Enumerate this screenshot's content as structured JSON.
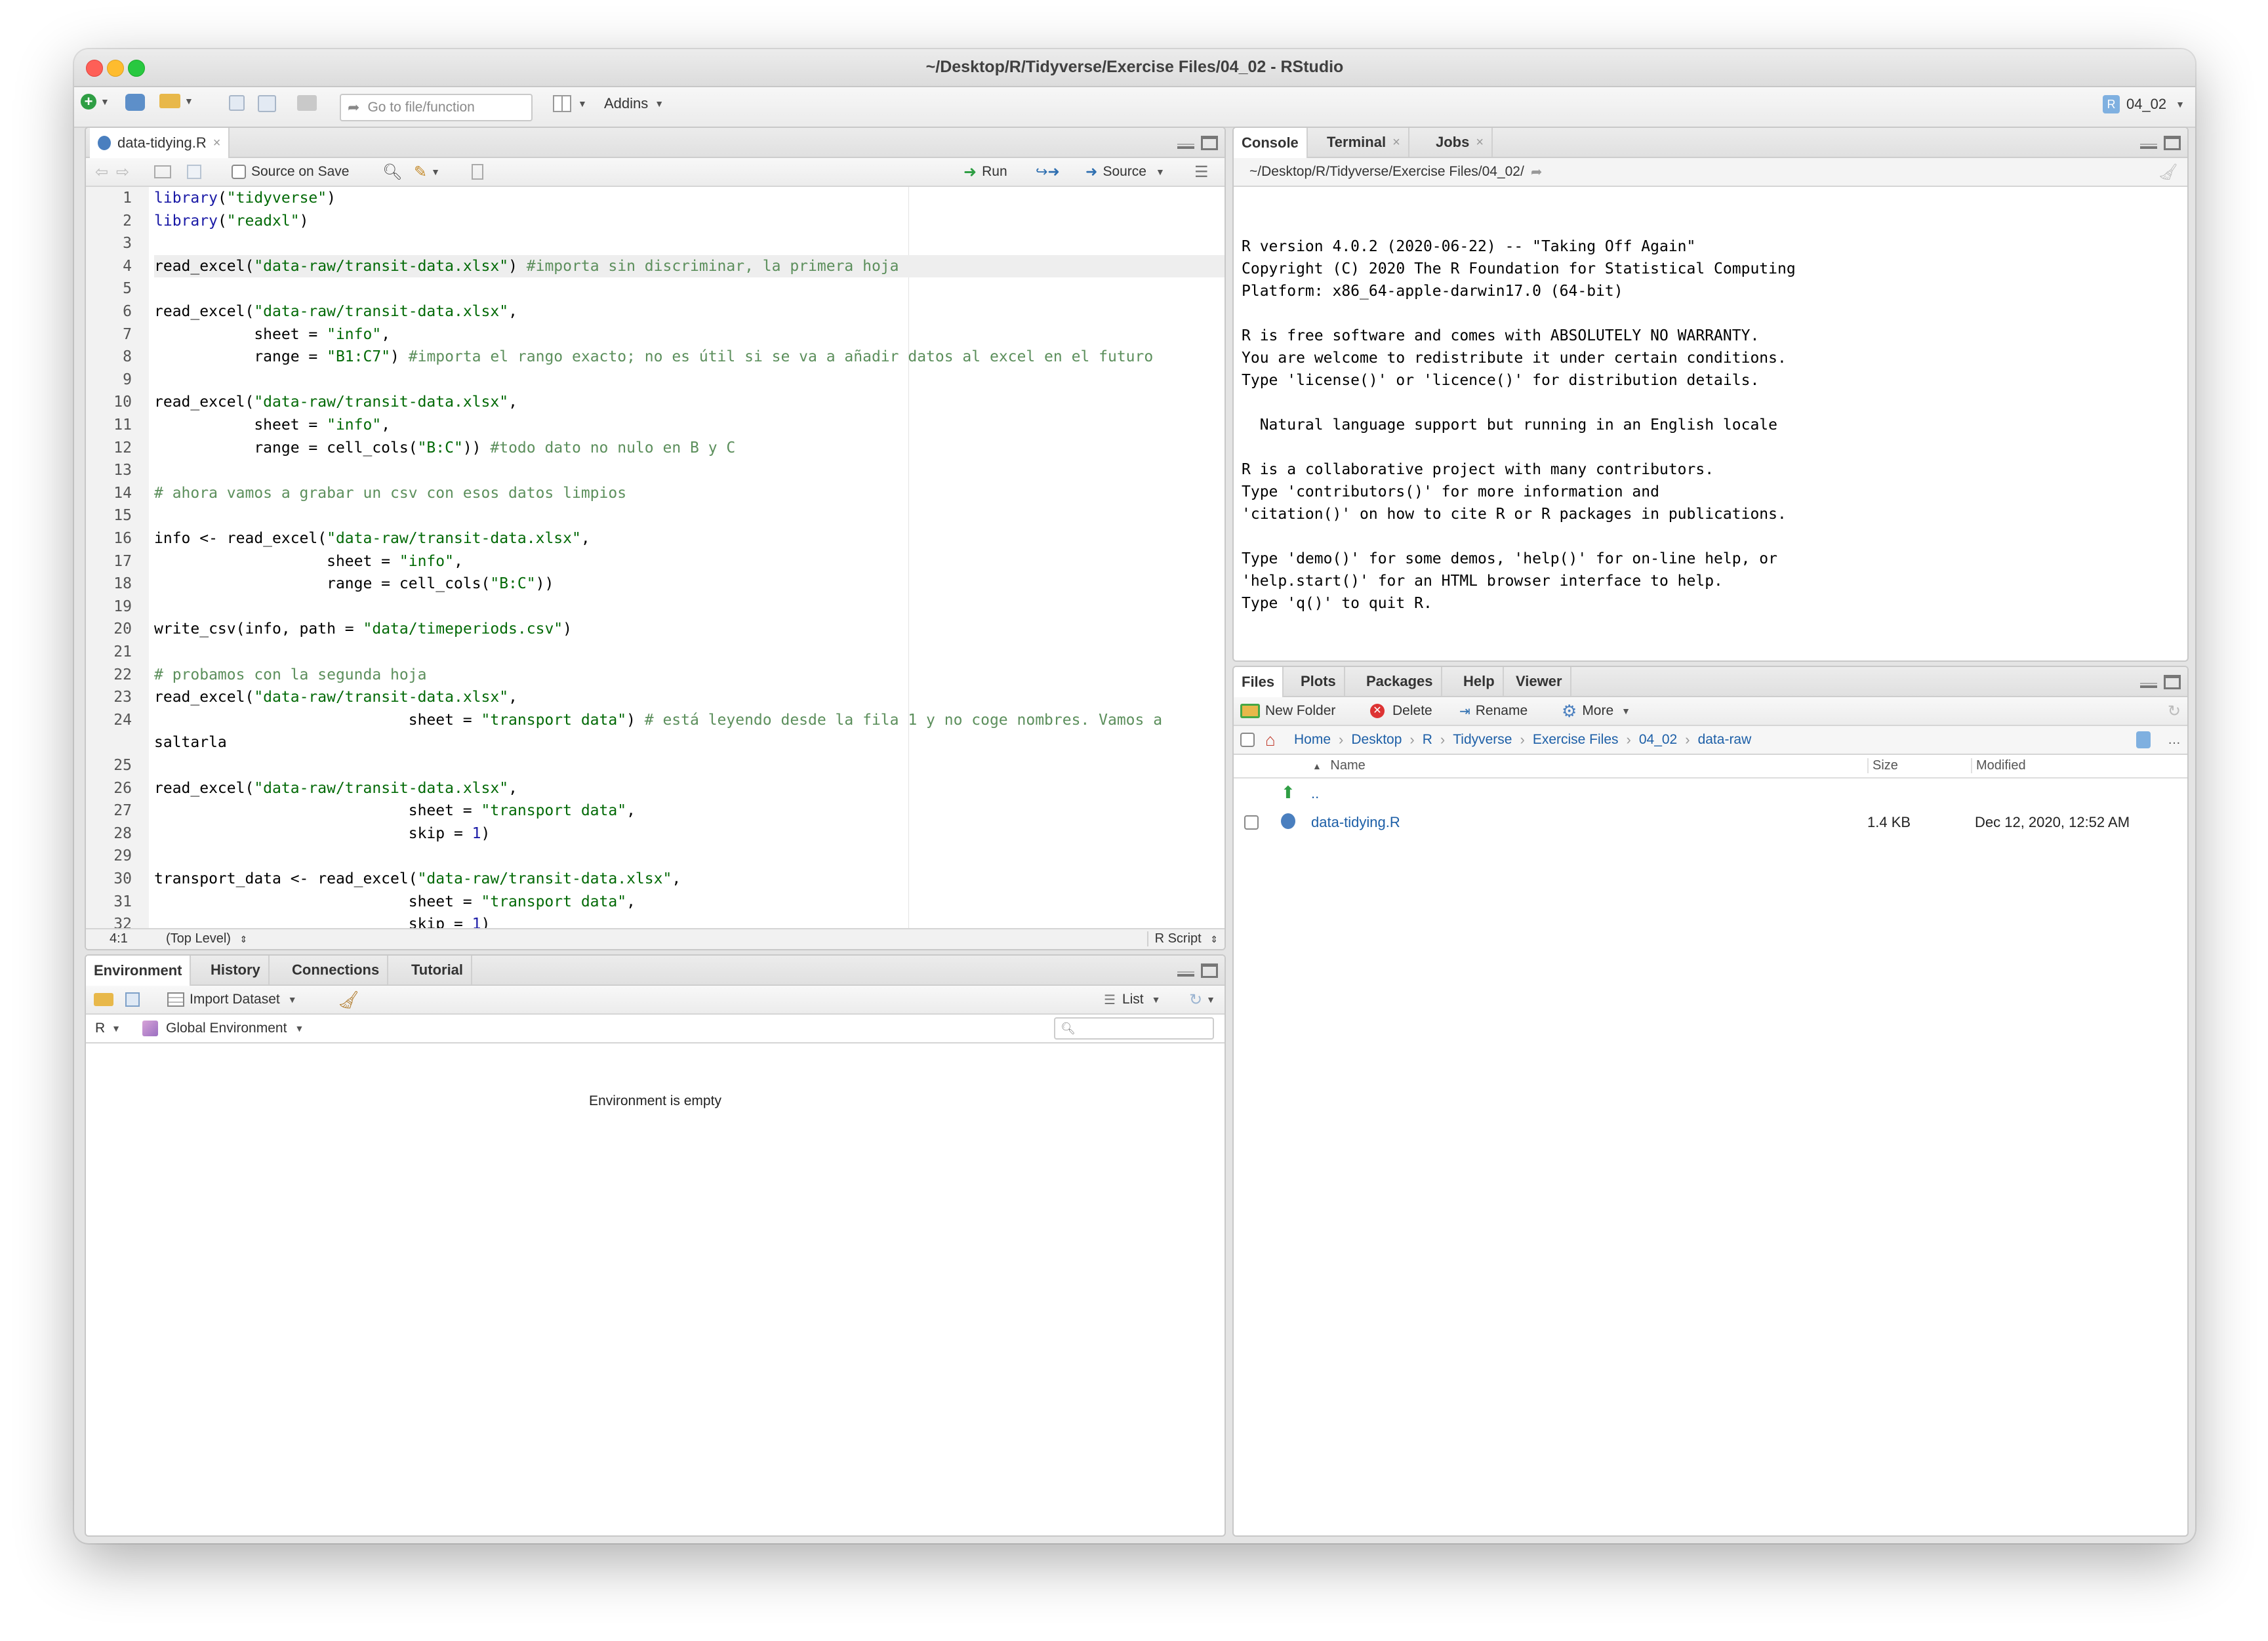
{
  "window": {
    "title": "~/Desktop/R/Tidyverse/Exercise Files/04_02 - RStudio"
  },
  "main_toolbar": {
    "goto_placeholder": "Go to file/function",
    "addins": "Addins",
    "project": "04_02"
  },
  "source_pane": {
    "tab_label": "data-tidying.R",
    "source_on_save": "Source on Save",
    "run": "Run",
    "source": "Source",
    "status_position": "4:1",
    "status_scope": "(Top Level)",
    "status_type": "R Script",
    "highlight_line": 4,
    "lines": [
      "library(\"tidyverse\")",
      "library(\"readxl\")",
      "",
      "read_excel(\"data-raw/transit-data.xlsx\") #importa sin discriminar, la primera hoja",
      "",
      "read_excel(\"data-raw/transit-data.xlsx\",",
      "           sheet = \"info\",",
      "           range = \"B1:C7\") #importa el rango exacto; no es útil si se va a añadir datos al excel en el futuro",
      "",
      "read_excel(\"data-raw/transit-data.xlsx\",",
      "           sheet = \"info\",",
      "           range = cell_cols(\"B:C\")) #todo dato no nulo en B y C",
      "",
      "# ahora vamos a grabar un csv con esos datos limpios",
      "",
      "info <- read_excel(\"data-raw/transit-data.xlsx\",",
      "                   sheet = \"info\",",
      "                   range = cell_cols(\"B:C\"))",
      "",
      "write_csv(info, path = \"data/timeperiods.csv\")",
      "",
      "# probamos con la segunda hoja",
      "read_excel(\"data-raw/transit-data.xlsx\",",
      "                            sheet = \"transport data\") # está leyendo desde la fila 1 y no coge nombres. Vamos a",
      "saltarla",
      "",
      "read_excel(\"data-raw/transit-data.xlsx\",",
      "                            sheet = \"transport data\",",
      "                            skip = 1)",
      "",
      "transport_data <- read_excel(\"data-raw/transit-data.xlsx\",",
      "                            sheet = \"transport data\",",
      "                            skip = 1)"
    ],
    "line_numbers": [
      "1",
      "2",
      "3",
      "4",
      "5",
      "6",
      "7",
      "8",
      "9",
      "10",
      "11",
      "12",
      "13",
      "14",
      "15",
      "16",
      "17",
      "18",
      "19",
      "20",
      "21",
      "22",
      "23",
      "24",
      "",
      "25",
      "26",
      "27",
      "28",
      "29",
      "30",
      "31",
      "32"
    ]
  },
  "env_pane": {
    "tabs": [
      "Environment",
      "History",
      "Connections",
      "Tutorial"
    ],
    "import_dataset": "Import Dataset",
    "list": "List",
    "lang": "R",
    "scope": "Global Environment",
    "empty_message": "Environment is empty"
  },
  "console_pane": {
    "tabs": [
      "Console",
      "Terminal",
      "Jobs"
    ],
    "path": "~/Desktop/R/Tidyverse/Exercise Files/04_02/",
    "lines": [
      "",
      "R version 4.0.2 (2020-06-22) -- \"Taking Off Again\"",
      "Copyright (C) 2020 The R Foundation for Statistical Computing",
      "Platform: x86_64-apple-darwin17.0 (64-bit)",
      "",
      "R is free software and comes with ABSOLUTELY NO WARRANTY.",
      "You are welcome to redistribute it under certain conditions.",
      "Type 'license()' or 'licence()' for distribution details.",
      "",
      "  Natural language support but running in an English locale",
      "",
      "R is a collaborative project with many contributors.",
      "Type 'contributors()' for more information and",
      "'citation()' on how to cite R or R packages in publications.",
      "",
      "Type 'demo()' for some demos, 'help()' for on-line help, or",
      "'help.start()' for an HTML browser interface to help.",
      "Type 'q()' to quit R.",
      ""
    ],
    "prompt": ">"
  },
  "files_pane": {
    "tabs": [
      "Files",
      "Plots",
      "Packages",
      "Help",
      "Viewer"
    ],
    "new_folder": "New Folder",
    "delete": "Delete",
    "rename": "Rename",
    "more": "More",
    "breadcrumb": [
      "Home",
      "Desktop",
      "R",
      "Tidyverse",
      "Exercise Files",
      "04_02",
      "data-raw"
    ],
    "columns": {
      "name": "Name",
      "size": "Size",
      "modified": "Modified"
    },
    "parent": "..",
    "files": [
      {
        "name": "data-tidying.R",
        "size": "1.4 KB",
        "modified": "Dec 12, 2020, 12:52 AM"
      }
    ]
  },
  "colors": {
    "keyword": "#1a1aa6",
    "string": "#036a07",
    "comment": "#5c8f5c",
    "number": "#1a1aa6",
    "link": "#1d5fa7"
  }
}
